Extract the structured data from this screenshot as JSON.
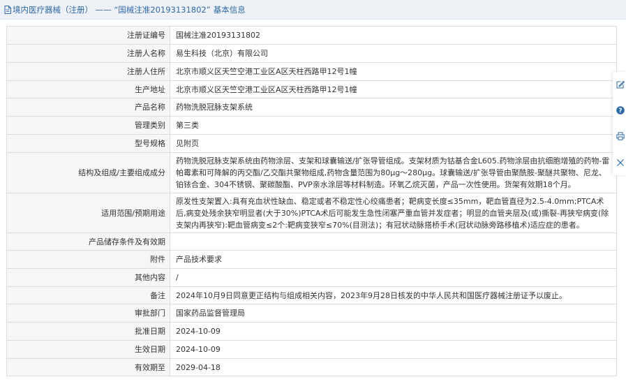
{
  "header": {
    "prefix": "境内医疗器械（注册）",
    "separator": " —— ",
    "record": "“国械注准20193131802”",
    "suffix": "基本信息"
  },
  "rows": [
    {
      "label": "注册证编号",
      "value": "国械注准20193131802"
    },
    {
      "label": "注册人名称",
      "value": "易生科技（北京）有限公司"
    },
    {
      "label": "注册人住所",
      "value": "北京市顺义区天竺空港工业区A区天柱西路甲12号1幢"
    },
    {
      "label": "生产地址",
      "value": "北京市顺义区天竺空港工业区A区天柱西路甲12号1幢"
    },
    {
      "label": "产品名称",
      "value": "药物洗脱冠脉支架系统"
    },
    {
      "label": "管理类别",
      "value": "第三类"
    },
    {
      "label": "型号规格",
      "value": "见附页"
    },
    {
      "label": "结构及组成/主要组成成分",
      "value": "药物洗脱冠脉支架系统由药物涂层、支架和球囊输送/扩张导管组成。支架材质为钴基合金L605.药物涂层由抗细胞增殖的药物-雷帕霉素和可降解的丙交酯/乙交酯共聚物组成,药物含量范围为80μg～280μg。球囊输送/扩张导管由聚酰胺-聚醚共聚物、尼龙、铂铱合金、304不锈钢、聚碳酸酯、PVP亲水涂层等材料制造。环氧乙烷灭菌，产品一次性使用。货架有效期18个月。"
    },
    {
      "label": "适用范围/预期用途",
      "value": "原发性支架置入:具有充血状性缺血、稳定或者不稳定性心绞痛患者；靶病变长度≤35mm，靶血管直径为2.5-4.0mm;PTCA术后,病变处残余狭窄明显者(大于30%)PTCA术后可能发生急性闭塞严重血管并发症者；明显的血管夹层及(或)撕裂-再狭窄病变(除支架内再狭窄):靶血管病变≤2个:靶病变狭窄≤70%(目测法)；有冠状动脉搭桥手术(冠状动脉旁路移植术)适应症的患者。"
    },
    {
      "label": "产品储存条件及有效期",
      "value": ""
    },
    {
      "label": "附件",
      "value": "产品技术要求"
    },
    {
      "label": "其他内容",
      "value": "/"
    },
    {
      "label": "备注",
      "value": "2024年10月9日同意更正结构与组成相关内容，2023年9月28日核发的中华人民共和国医疗器械注册证予以废止。"
    },
    {
      "label": "审批部门",
      "value": "国家药品监督管理局"
    },
    {
      "label": "批准日期",
      "value": "2024-10-09"
    },
    {
      "label": "生效日期",
      "value": "2024-10-09"
    },
    {
      "label": "有效期至",
      "value": "2029-04-18"
    }
  ],
  "side_toolbar": {
    "icons": [
      "edit-icon",
      "help-icon",
      "print-icon",
      "close-icon"
    ],
    "accent": "#2e6aa8"
  },
  "colors": {
    "title": "#2e6aa8",
    "header_bg": "#eef1f6",
    "label_bg": "#f5f6f8",
    "border": "#dcdcdc"
  }
}
